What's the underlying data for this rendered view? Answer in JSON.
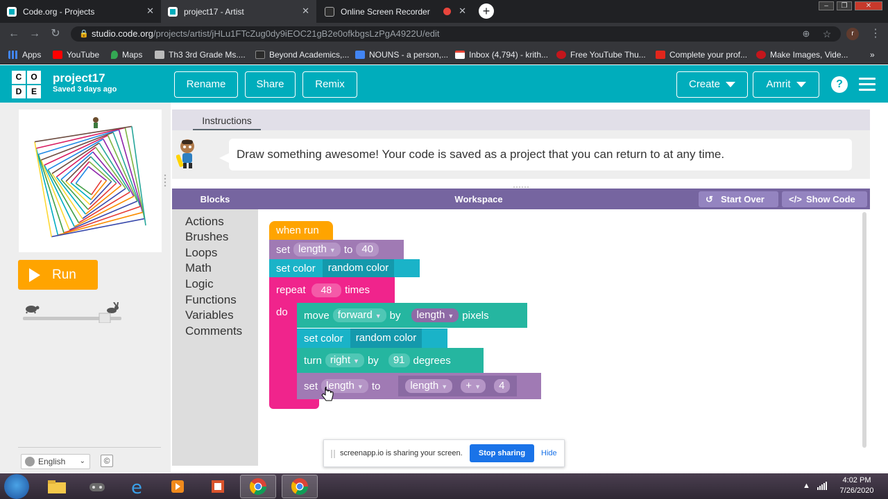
{
  "browser": {
    "tabs": [
      {
        "title": "Code.org - Projects",
        "active": false
      },
      {
        "title": "project17 - Artist",
        "active": true
      },
      {
        "title": "Online Screen Recorder",
        "active": false,
        "recording": true
      }
    ],
    "url_host": "studio.code.org",
    "url_path": "/projects/artist/jHLu1FTcZug0dy9iEOC21gB2e0ofkbgsLzPgA4922U/edit",
    "profile_initial": "r",
    "bookmarks": [
      {
        "label": "Apps"
      },
      {
        "label": "YouTube"
      },
      {
        "label": "Maps"
      },
      {
        "label": "Th3 3rd Grade Ms...."
      },
      {
        "label": "Beyond Academics,..."
      },
      {
        "label": "NOUNS - a person,..."
      },
      {
        "label": "Inbox (4,794) - krith..."
      },
      {
        "label": "Free YouTube Thu..."
      },
      {
        "label": "Complete your prof..."
      },
      {
        "label": "Make Images, Vide..."
      }
    ]
  },
  "header": {
    "logo_letters": [
      "C",
      "O",
      "D",
      "E"
    ],
    "project_name": "project17",
    "saved_status": "Saved 3 days ago",
    "rename_label": "Rename",
    "share_label": "Share",
    "remix_label": "Remix",
    "create_label": "Create",
    "user_label": "Amrit",
    "help_label": "?"
  },
  "left": {
    "run_label": "Run",
    "language": "English",
    "cc_label": "©"
  },
  "instructions": {
    "tab_label": "Instructions",
    "text": "Draw something awesome! Your code is saved as a project that you can return to at any time."
  },
  "workspace_header": {
    "blocks_label": "Blocks",
    "workspace_label": "Workspace",
    "start_over_label": "Start Over",
    "show_code_label": "Show Code"
  },
  "toolbox": {
    "categories": [
      "Actions",
      "Brushes",
      "Loops",
      "Math",
      "Logic",
      "Functions",
      "Variables",
      "Comments"
    ]
  },
  "program": {
    "when_run": "when run",
    "set1": {
      "kw": "set",
      "var": "length",
      "to": "to",
      "value": "40"
    },
    "setcolor1": {
      "kw": "set color",
      "value": "random color"
    },
    "repeat": {
      "kw": "repeat",
      "count": "48",
      "times": "times",
      "do": "do"
    },
    "move": {
      "kw": "move",
      "dir": "forward",
      "by": "by",
      "var": "length",
      "unit": "pixels"
    },
    "setcolor2": {
      "kw": "set color",
      "value": "random color"
    },
    "turn": {
      "kw": "turn",
      "dir": "right",
      "by": "by",
      "value": "91",
      "unit": "degrees"
    },
    "set2": {
      "kw": "set",
      "var": "length",
      "to": "to",
      "expr_var": "length",
      "op": "+",
      "value": "4"
    }
  },
  "sharebar": {
    "text": "screenapp.io is sharing your screen.",
    "stop_label": "Stop sharing",
    "hide_label": "Hide"
  },
  "taskbar": {
    "time": "4:02 PM",
    "date": "7/26/2020"
  },
  "colors": {
    "codeorg_teal": "#00adbc",
    "run_orange": "#ffa400",
    "workspace_purple": "#7665a0",
    "block_pink": "#f0248c",
    "block_teal": "#1ab3c8",
    "block_purple": "#a07ab4"
  }
}
